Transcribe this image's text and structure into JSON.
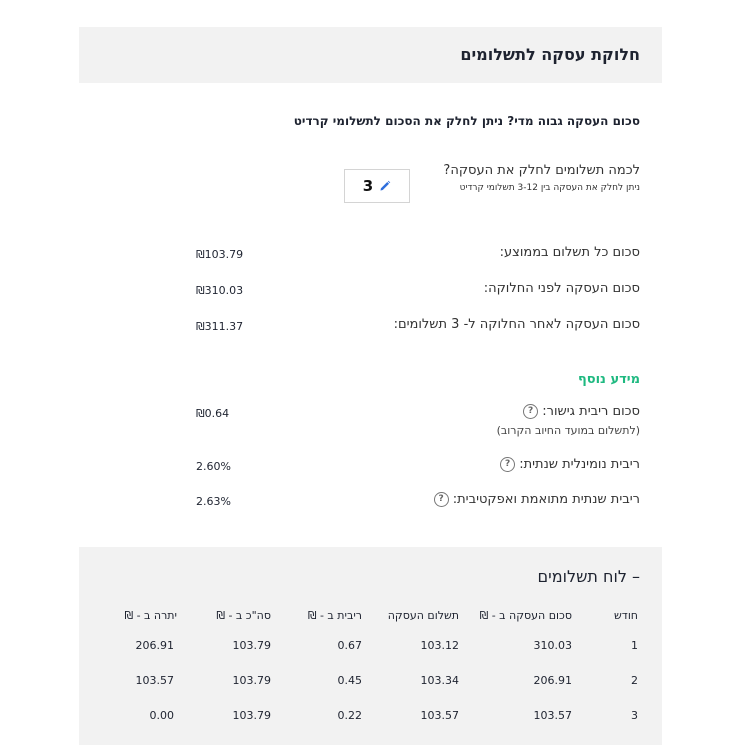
{
  "header": {
    "title": "חלוקת עסקה לתשלומים"
  },
  "intro": {
    "subtitle": "סכום העסקה גבוה מדי? ניתן לחלק את הסכום לתשלומי קרדיט"
  },
  "installments": {
    "question": "לכמה תשלומים לחלק את העסקה?",
    "hint": "ניתן לחלק את העסקה בין 3-12 תשלומי קרדיט",
    "value": "3",
    "edit_icon": "pencil-icon"
  },
  "summary": [
    {
      "label": "סכום כל תשלום בממוצע:",
      "value": "₪103.79"
    },
    {
      "label": "סכום העסקה לפני החלוקה:",
      "value": "₪310.03"
    },
    {
      "label": "סכום העסקה לאחר החלוקה ל- 3 תשלומים:",
      "value": "₪311.37"
    }
  ],
  "more_info": {
    "title": "מידע נוסף",
    "items": [
      {
        "label": "סכום ריבית גישור:",
        "note": "(לתשלום במועד החיוב הקרוב)",
        "value": "₪0.64",
        "help": "?"
      },
      {
        "label": "ריבית נומינלית שנתית:",
        "value": "2.60%",
        "help": "?"
      },
      {
        "label": "ריבית שנתית מתואמת ואפקטיבית:",
        "value": "2.63%",
        "help": "?"
      }
    ]
  },
  "schedule": {
    "title": "– לוח תשלומים",
    "columns": [
      "חודש",
      "סכום העסקה ב - ₪",
      "תשלום העסקה",
      "ריבית ב - ₪",
      "סה\"כ ב - ₪",
      "יתרה ב - ₪"
    ],
    "rows": [
      [
        "1",
        "310.03",
        "103.12",
        "0.67",
        "103.79",
        "206.91"
      ],
      [
        "2",
        "206.91",
        "103.34",
        "0.45",
        "103.79",
        "103.57"
      ],
      [
        "3",
        "103.57",
        "103.57",
        "0.22",
        "103.79",
        "0.00"
      ]
    ]
  },
  "colors": {
    "accent": "#1eb980",
    "header_bg": "#f2f2f2",
    "text": "#1e2330",
    "icon_blue": "#2f6fdc"
  }
}
